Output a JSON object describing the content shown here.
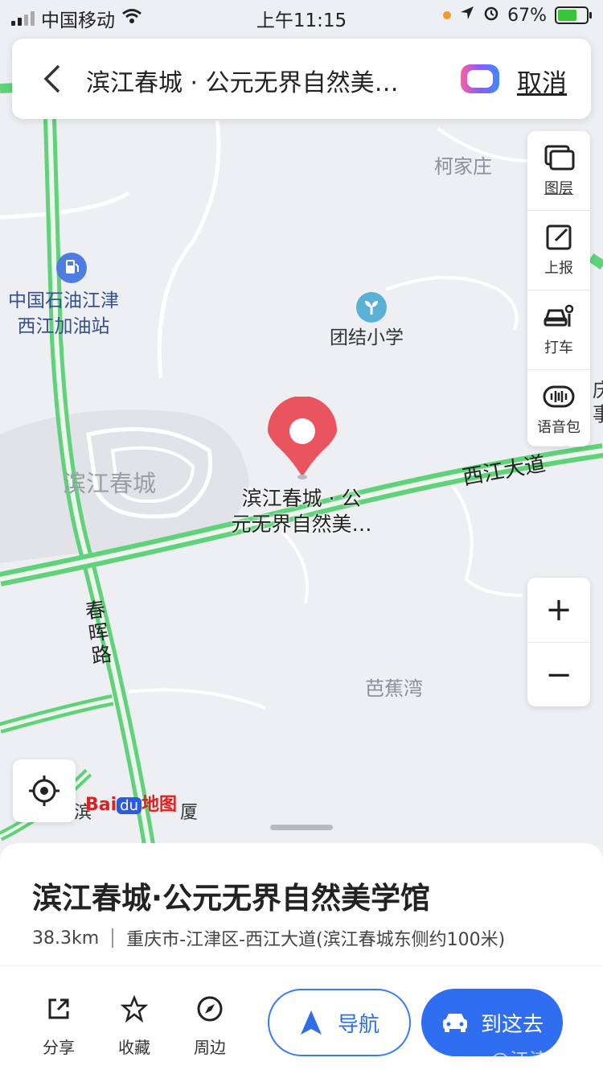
{
  "status": {
    "carrier": "中国移动",
    "time": "上午11:15",
    "battery": "67%",
    "battery_level": 0.67
  },
  "search": {
    "query": "滨江春城 · 公元无界自然美…",
    "cancel_label": "取消"
  },
  "toolbar": {
    "items": [
      {
        "label": "图层",
        "icon": "layers-icon"
      },
      {
        "label": "上报",
        "icon": "report-icon"
      },
      {
        "label": "打车",
        "icon": "taxi-icon"
      },
      {
        "label": "语音包",
        "icon": "voice-icon"
      }
    ]
  },
  "zoom": {
    "in": "+",
    "out": "−"
  },
  "map": {
    "labels": {
      "kejiazhuang": "柯家庄",
      "gas_station_l1": "中国石油江津",
      "gas_station_l2": "西江加油站",
      "school": "团结小学",
      "binjiang": "滨江春城",
      "xijiang_road": "西江大道",
      "chunhui_road_1": "春",
      "chunhui_road_2": "晖",
      "chunhui_road_3": "路",
      "bajiaowan": "芭蕉湾",
      "edge_1": "庆",
      "edge_2": "事",
      "bottom_partial_1": "滨",
      "bottom_partial_2": "厦"
    },
    "pin_label_line1": "滨江春城 · 公",
    "pin_label_line2": "元无界自然美…",
    "brand": {
      "bai": "Bai",
      "du": "du",
      "map": "地图"
    }
  },
  "place": {
    "title": "滨江春城·公元无界自然美学馆",
    "distance": "38.3km",
    "address": "重庆市-江津区-西江大道(滨江春城东侧约100米)"
  },
  "actions": {
    "share": "分享",
    "favorite": "收藏",
    "nearby": "周边",
    "navigate": "导航",
    "go": "到这去"
  },
  "watermark": "@江津在",
  "colors": {
    "road_green": "#5fd27a",
    "pin_red": "#e9545f",
    "primary_blue": "#2f6ef0",
    "poi_blue": "#35508c"
  }
}
